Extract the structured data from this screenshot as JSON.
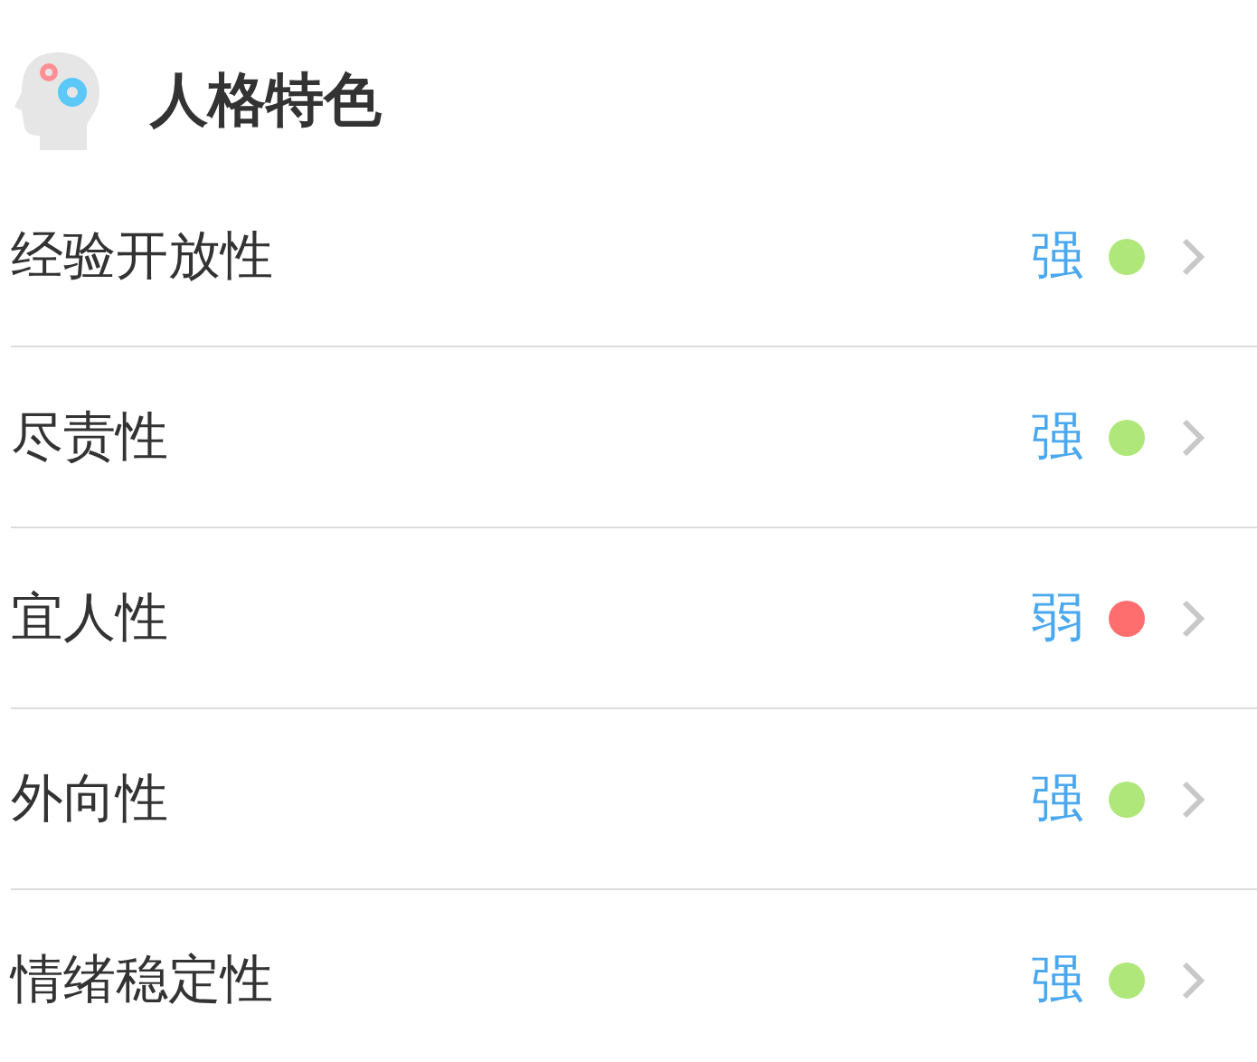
{
  "header": {
    "title": "人格特色"
  },
  "traits": [
    {
      "name": "经验开放性",
      "level_text": "强",
      "color": "#b0e77a"
    },
    {
      "name": "尽责性",
      "level_text": "强",
      "color": "#b0e77a"
    },
    {
      "name": "宜人性",
      "level_text": "弱",
      "color": "#ff6e6e"
    },
    {
      "name": "外向性",
      "level_text": "强",
      "color": "#b0e77a"
    },
    {
      "name": "情绪稳定性",
      "level_text": "强",
      "color": "#b0e77a"
    }
  ]
}
